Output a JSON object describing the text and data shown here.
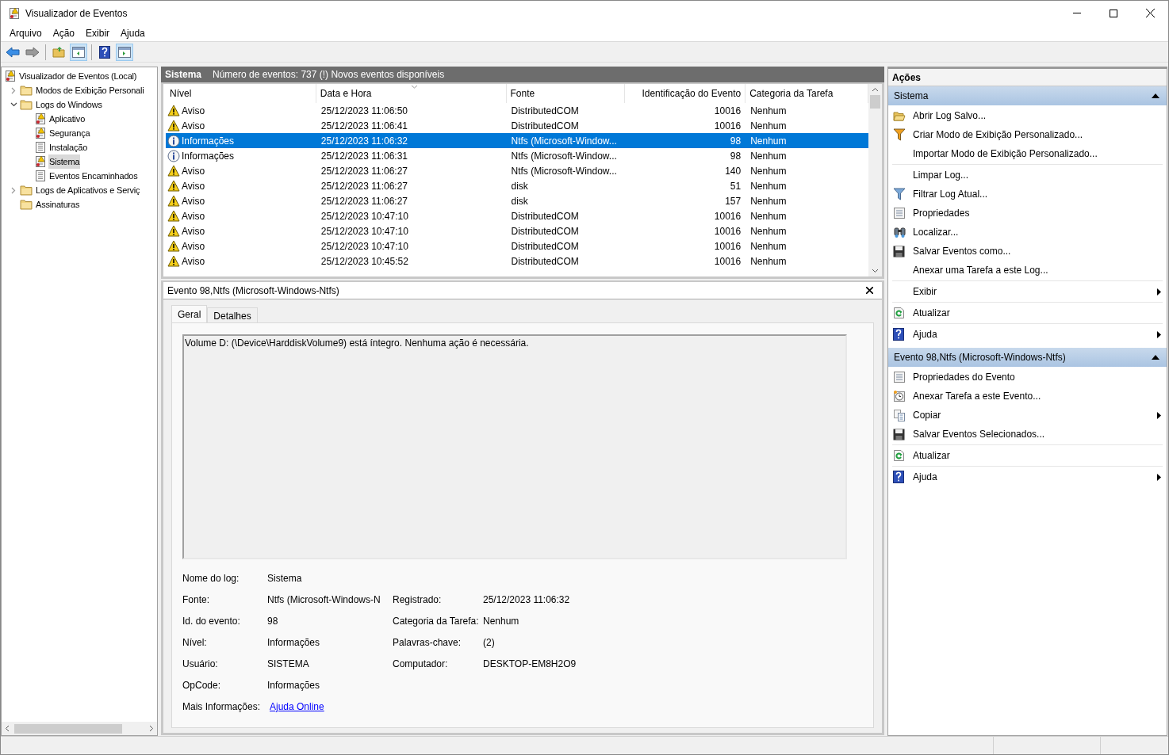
{
  "window": {
    "title": "Visualizador de Eventos"
  },
  "menu": [
    "Arquivo",
    "Ação",
    "Exibir",
    "Ajuda"
  ],
  "toolbar": [
    {
      "kind": "back",
      "pressed": false
    },
    {
      "kind": "forward",
      "pressed": false
    },
    {
      "kind": "folder-up",
      "pressed": false
    },
    {
      "kind": "pane",
      "pressed": true
    },
    {
      "kind": "help",
      "pressed": false
    },
    {
      "kind": "pane-right",
      "pressed": true
    }
  ],
  "tree": [
    {
      "label": "Visualizador de Eventos (Local)",
      "kind": "log",
      "selected": false,
      "children": [
        {
          "label": "Modos de Exibição Personali",
          "kind": "folder",
          "selected": false,
          "expanded": false
        },
        {
          "label": "Logs do Windows",
          "kind": "folder",
          "selected": false,
          "expanded": true,
          "children": [
            {
              "label": "Aplicativo",
              "kind": "log",
              "selected": false
            },
            {
              "label": "Segurança",
              "kind": "log",
              "selected": false
            },
            {
              "label": "Instalação",
              "kind": "list",
              "selected": false
            },
            {
              "label": "Sistema",
              "kind": "log",
              "selected": true
            },
            {
              "label": "Eventos Encaminhados",
              "kind": "list",
              "selected": false
            }
          ]
        },
        {
          "label": "Logs de Aplicativos e Serviç",
          "kind": "folder",
          "selected": false,
          "expanded": false
        },
        {
          "label": "Assinaturas",
          "kind": "folder",
          "selected": false
        }
      ]
    }
  ],
  "log_header": {
    "name": "Sistema",
    "info": "Número de eventos: 737 (!) Novos eventos disponíveis"
  },
  "table": {
    "columns": [
      {
        "label": "Nível",
        "sorted": false
      },
      {
        "label": "Data e Hora",
        "sorted": true
      },
      {
        "label": "Fonte",
        "sorted": false
      },
      {
        "label": "Identificação do Evento",
        "sorted": false
      },
      {
        "label": "Categoria da Tarefa",
        "sorted": false
      }
    ],
    "rows": [
      {
        "kind": "warning",
        "selected": false,
        "cells": [
          "Aviso",
          "25/12/2023 11:06:50",
          "DistributedCOM",
          "10016",
          "Nenhum"
        ]
      },
      {
        "kind": "warning",
        "selected": false,
        "cells": [
          "Aviso",
          "25/12/2023 11:06:41",
          "DistributedCOM",
          "10016",
          "Nenhum"
        ]
      },
      {
        "kind": "info",
        "selected": true,
        "cells": [
          "Informações",
          "25/12/2023 11:06:32",
          "Ntfs (Microsoft-Window...",
          "98",
          "Nenhum"
        ]
      },
      {
        "kind": "info",
        "selected": false,
        "cells": [
          "Informações",
          "25/12/2023 11:06:31",
          "Ntfs (Microsoft-Window...",
          "98",
          "Nenhum"
        ]
      },
      {
        "kind": "warning",
        "selected": false,
        "cells": [
          "Aviso",
          "25/12/2023 11:06:27",
          "Ntfs (Microsoft-Window...",
          "140",
          "Nenhum"
        ]
      },
      {
        "kind": "warning",
        "selected": false,
        "cells": [
          "Aviso",
          "25/12/2023 11:06:27",
          "disk",
          "51",
          "Nenhum"
        ]
      },
      {
        "kind": "warning",
        "selected": false,
        "cells": [
          "Aviso",
          "25/12/2023 11:06:27",
          "disk",
          "157",
          "Nenhum"
        ]
      },
      {
        "kind": "warning",
        "selected": false,
        "cells": [
          "Aviso",
          "25/12/2023 10:47:10",
          "DistributedCOM",
          "10016",
          "Nenhum"
        ]
      },
      {
        "kind": "warning",
        "selected": false,
        "cells": [
          "Aviso",
          "25/12/2023 10:47:10",
          "DistributedCOM",
          "10016",
          "Nenhum"
        ]
      },
      {
        "kind": "warning",
        "selected": false,
        "cells": [
          "Aviso",
          "25/12/2023 10:47:10",
          "DistributedCOM",
          "10016",
          "Nenhum"
        ]
      },
      {
        "kind": "warning",
        "selected": false,
        "cells": [
          "Aviso",
          "25/12/2023 10:45:52",
          "DistributedCOM",
          "10016",
          "Nenhum"
        ]
      }
    ]
  },
  "details": {
    "title": "Evento 98,Ntfs (Microsoft-Windows-Ntfs)",
    "tabs": [
      {
        "label": "Geral",
        "selected": true
      },
      {
        "label": "Detalhes",
        "selected": false
      }
    ],
    "message": "Volume D: (\\Device\\HarddiskVolume9) está íntegro. Nenhuma ação é necessária.",
    "fields": [
      {
        "label": "Nome do log:",
        "value": "Sistema"
      },
      {
        "label": "Fonte:",
        "value": "Ntfs (Microsoft-Windows-N",
        "label2": "Registrado:",
        "value2": "25/12/2023 11:06:32"
      },
      {
        "label": "Id. do evento:",
        "value": "98",
        "label2": "Categoria da Tarefa:",
        "value2": "Nenhum"
      },
      {
        "label": "Nível:",
        "value": "Informações",
        "label2": "Palavras-chave:",
        "value2": "(2)"
      },
      {
        "label": "Usuário:",
        "value": "SISTEMA",
        "label2": "Computador:",
        "value2": "DESKTOP-EM8H2O9"
      },
      {
        "label": "OpCode:",
        "value": "Informações"
      },
      {
        "label": "Mais Informações:",
        "value": "Ajuda Online",
        "kind": "link"
      }
    ]
  },
  "actions": {
    "title": "Ações",
    "sections": [
      {
        "title": "Sistema",
        "expanded": true,
        "groups": [
          [
            {
              "label": "Abrir Log Salvo...",
              "kind": "open"
            },
            {
              "label": "Criar Modo de Exibição Personalizado...",
              "kind": "filter-color"
            },
            {
              "label": "Importar Modo de Exibição Personalizado...",
              "kind": "none"
            }
          ],
          [
            {
              "label": "Limpar Log...",
              "kind": "none"
            },
            {
              "label": "Filtrar Log Atual...",
              "kind": "filter"
            },
            {
              "label": "Propriedades",
              "kind": "properties"
            },
            {
              "label": "Localizar...",
              "kind": "binoculars"
            },
            {
              "label": "Salvar Eventos como...",
              "kind": "save"
            },
            {
              "label": "Anexar uma Tarefa a este Log...",
              "kind": "none"
            }
          ],
          [
            {
              "label": "Exibir",
              "kind": "none",
              "submenu": true
            }
          ],
          [
            {
              "label": "Atualizar",
              "kind": "refresh"
            }
          ],
          [
            {
              "label": "Ajuda",
              "kind": "help",
              "submenu": true
            }
          ]
        ]
      },
      {
        "title": "Evento 98,Ntfs (Microsoft-Windows-Ntfs)",
        "expanded": true,
        "groups": [
          [
            {
              "label": "Propriedades do Evento",
              "kind": "properties"
            },
            {
              "label": "Anexar Tarefa a este Evento...",
              "kind": "clock"
            },
            {
              "label": "Copiar",
              "kind": "copy",
              "submenu": true
            },
            {
              "label": "Salvar Eventos Selecionados...",
              "kind": "save"
            }
          ],
          [
            {
              "label": "Atualizar",
              "kind": "refresh"
            }
          ],
          [
            {
              "label": "Ajuda",
              "kind": "help",
              "submenu": true
            }
          ]
        ]
      }
    ]
  }
}
